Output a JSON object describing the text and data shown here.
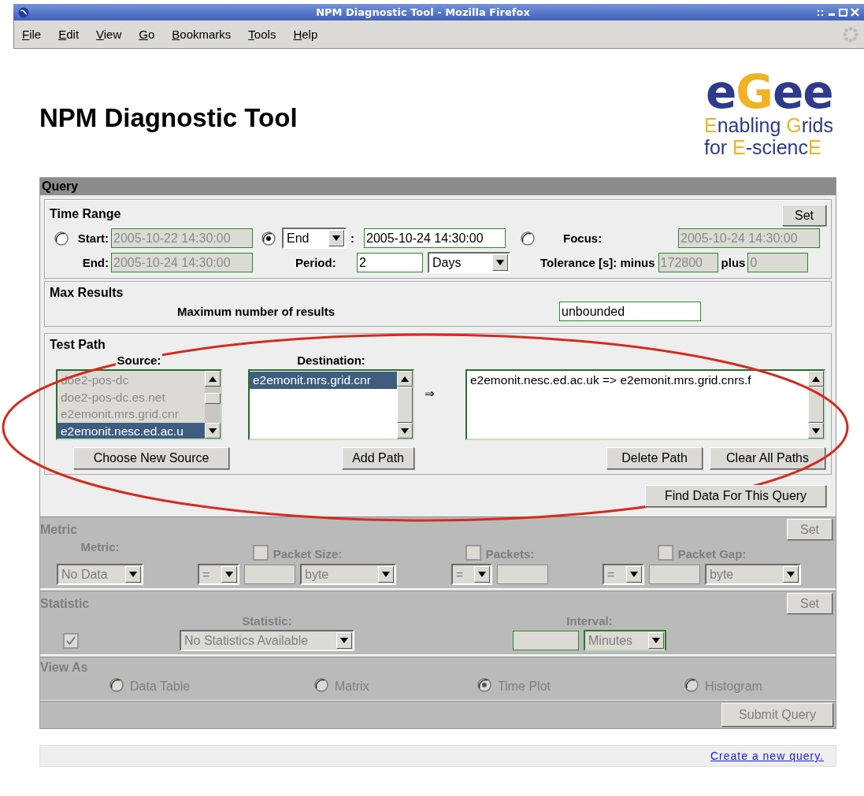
{
  "window": {
    "title": "NPM Diagnostic Tool - Mozilla Firefox"
  },
  "menu": [
    {
      "label": "File"
    },
    {
      "label": "Edit"
    },
    {
      "label": "View"
    },
    {
      "label": "Go"
    },
    {
      "label": "Bookmarks"
    },
    {
      "label": "Tools"
    },
    {
      "label": "Help"
    }
  ],
  "page": {
    "heading": "NPM Diagnostic Tool",
    "logo": {
      "wordmark": [
        {
          "text": "e",
          "color": "#2e3a8c"
        },
        {
          "text": "G",
          "color": "#f0b323"
        },
        {
          "text": "ee",
          "color": "#2e3a8c"
        }
      ],
      "lines": [
        [
          {
            "text": "E",
            "color": "#f0b323"
          },
          {
            "text": "nabling ",
            "color": "#2e3a8c"
          },
          {
            "text": "G",
            "color": "#f0b323"
          },
          {
            "text": "rids",
            "color": "#2e3a8c"
          }
        ],
        [
          {
            "text": "for ",
            "color": "#2e3a8c"
          },
          {
            "text": "E",
            "color": "#f0b323"
          },
          {
            "text": "-scienc",
            "color": "#2e3a8c"
          },
          {
            "text": "E",
            "color": "#f0b323"
          }
        ]
      ]
    }
  },
  "query": {
    "title": "Query",
    "time_range": {
      "title": "Time Range",
      "set_button": "Set",
      "start": {
        "label": "Start:",
        "value": "2005-10-22 14:30:00",
        "selected": false,
        "disabled": true
      },
      "end_mode": {
        "option": "End",
        "separator": ":",
        "value": "2005-10-24 14:30:00",
        "selected": true,
        "disabled": false
      },
      "focus": {
        "label": "Focus:",
        "value": "2005-10-24 14:30:00",
        "selected": false,
        "disabled": true
      },
      "end": {
        "label": "End:",
        "value": "2005-10-24 14:30:00",
        "disabled": true
      },
      "period": {
        "label": "Period:",
        "value": "2",
        "unit": "Days",
        "disabled": false
      },
      "tolerance": {
        "label": "Tolerance [s]: minus",
        "minus": "172800",
        "plus_label": "plus",
        "plus": "0",
        "disabled": true
      }
    },
    "max_results": {
      "title": "Max Results",
      "label": "Maximum number of results",
      "value": "unbounded"
    },
    "test_path": {
      "title": "Test Path",
      "source": {
        "label": "Source:",
        "disabled": true,
        "items": [
          {
            "text": "doe2-pos-dc",
            "selected": false
          },
          {
            "text": "doe2-pos-dc.es.net",
            "selected": false
          },
          {
            "text": "e2emonit.mrs.grid.cnr",
            "selected": false
          },
          {
            "text": "e2emonit.nesc.ed.ac.u",
            "selected": true
          }
        ]
      },
      "destination": {
        "label": "Destination:",
        "disabled": false,
        "items": [
          {
            "text": "e2emonit.mrs.grid.cnr",
            "selected": true
          }
        ]
      },
      "arrow": "⇒",
      "paths": [
        {
          "text": "e2emonit.nesc.ed.ac.uk => e2emonit.mrs.grid.cnrs.f",
          "selected": false
        }
      ],
      "buttons": {
        "choose": "Choose New Source",
        "add": "Add Path",
        "delete": "Delete Path",
        "clear": "Clear All Paths"
      }
    },
    "find_button": "Find Data For This Query"
  },
  "metric": {
    "title": "Metric",
    "disabled": true,
    "set_button": "Set",
    "label": "Metric:",
    "value": "No Data",
    "filters": [
      {
        "label": "Packet Size:",
        "checked": false,
        "operator": "=",
        "unit": "byte"
      },
      {
        "label": "Packets:",
        "checked": false,
        "operator": "="
      },
      {
        "label": "Packet Gap:",
        "checked": false,
        "operator": "=",
        "unit": "byte"
      }
    ]
  },
  "statistic": {
    "title": "Statistic",
    "disabled": true,
    "set_button": "Set",
    "enabled_checkbox": {
      "checked": true
    },
    "label": "Statistic:",
    "value": "No Statistics Available",
    "interval_label": "Interval:",
    "interval_unit": "Minutes"
  },
  "view_as": {
    "title": "View As",
    "disabled": true,
    "options": [
      {
        "label": "Data Table",
        "selected": false
      },
      {
        "label": "Matrix",
        "selected": false
      },
      {
        "label": "Time Plot",
        "selected": true
      },
      {
        "label": "Histogram",
        "selected": false
      }
    ]
  },
  "submit_button": "Submit Query",
  "footer": {
    "link": "Create a new query."
  }
}
